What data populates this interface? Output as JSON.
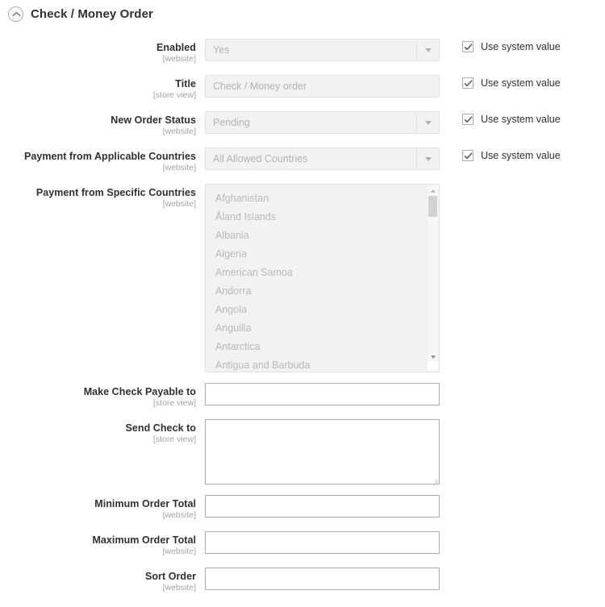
{
  "section": {
    "title": "Check / Money Order",
    "collapse_icon": "chevron-up-circle-icon"
  },
  "fields": [
    {
      "label": "Enabled",
      "scope": "[website]",
      "type": "select",
      "value": "Yes",
      "disabled": true,
      "use_system_value": {
        "label": "Use system value",
        "checked": true
      }
    },
    {
      "label": "Title",
      "scope": "[store view]",
      "type": "text",
      "value": "Check / Money order",
      "disabled": true,
      "use_system_value": {
        "label": "Use system value",
        "checked": true
      }
    },
    {
      "label": "New Order Status",
      "scope": "[website]",
      "type": "select",
      "value": "Pending",
      "disabled": true,
      "use_system_value": {
        "label": "Use system value",
        "checked": true
      }
    },
    {
      "label": "Payment from Applicable Countries",
      "scope": "[website]",
      "type": "select",
      "value": "All Allowed Countries",
      "disabled": true,
      "use_system_value": {
        "label": "Use system value",
        "checked": true
      }
    },
    {
      "label": "Payment from Specific Countries",
      "scope": "[website]",
      "type": "multiselect",
      "disabled": true,
      "options": [
        "Afghanistan",
        "Åland Islands",
        "Albania",
        "Algeria",
        "American Samoa",
        "Andorra",
        "Angola",
        "Anguilla",
        "Antarctica",
        "Antigua and Barbuda"
      ]
    },
    {
      "label": "Make Check Payable to",
      "scope": "[store view]",
      "type": "text",
      "value": "",
      "disabled": false
    },
    {
      "label": "Send Check to",
      "scope": "[store view]",
      "type": "textarea",
      "value": "",
      "disabled": false
    },
    {
      "label": "Minimum Order Total",
      "scope": "[website]",
      "type": "text",
      "value": "",
      "disabled": false
    },
    {
      "label": "Maximum Order Total",
      "scope": "[website]",
      "type": "text",
      "value": "",
      "disabled": false
    },
    {
      "label": "Sort Order",
      "scope": "[website]",
      "type": "text",
      "value": "",
      "disabled": false
    }
  ],
  "colors": {
    "text": "#303030",
    "muted": "#a3a3a3",
    "disabled_bg": "#f2f2f2",
    "disabled_border": "#e3e3e3",
    "enabled_border": "#adadad"
  }
}
